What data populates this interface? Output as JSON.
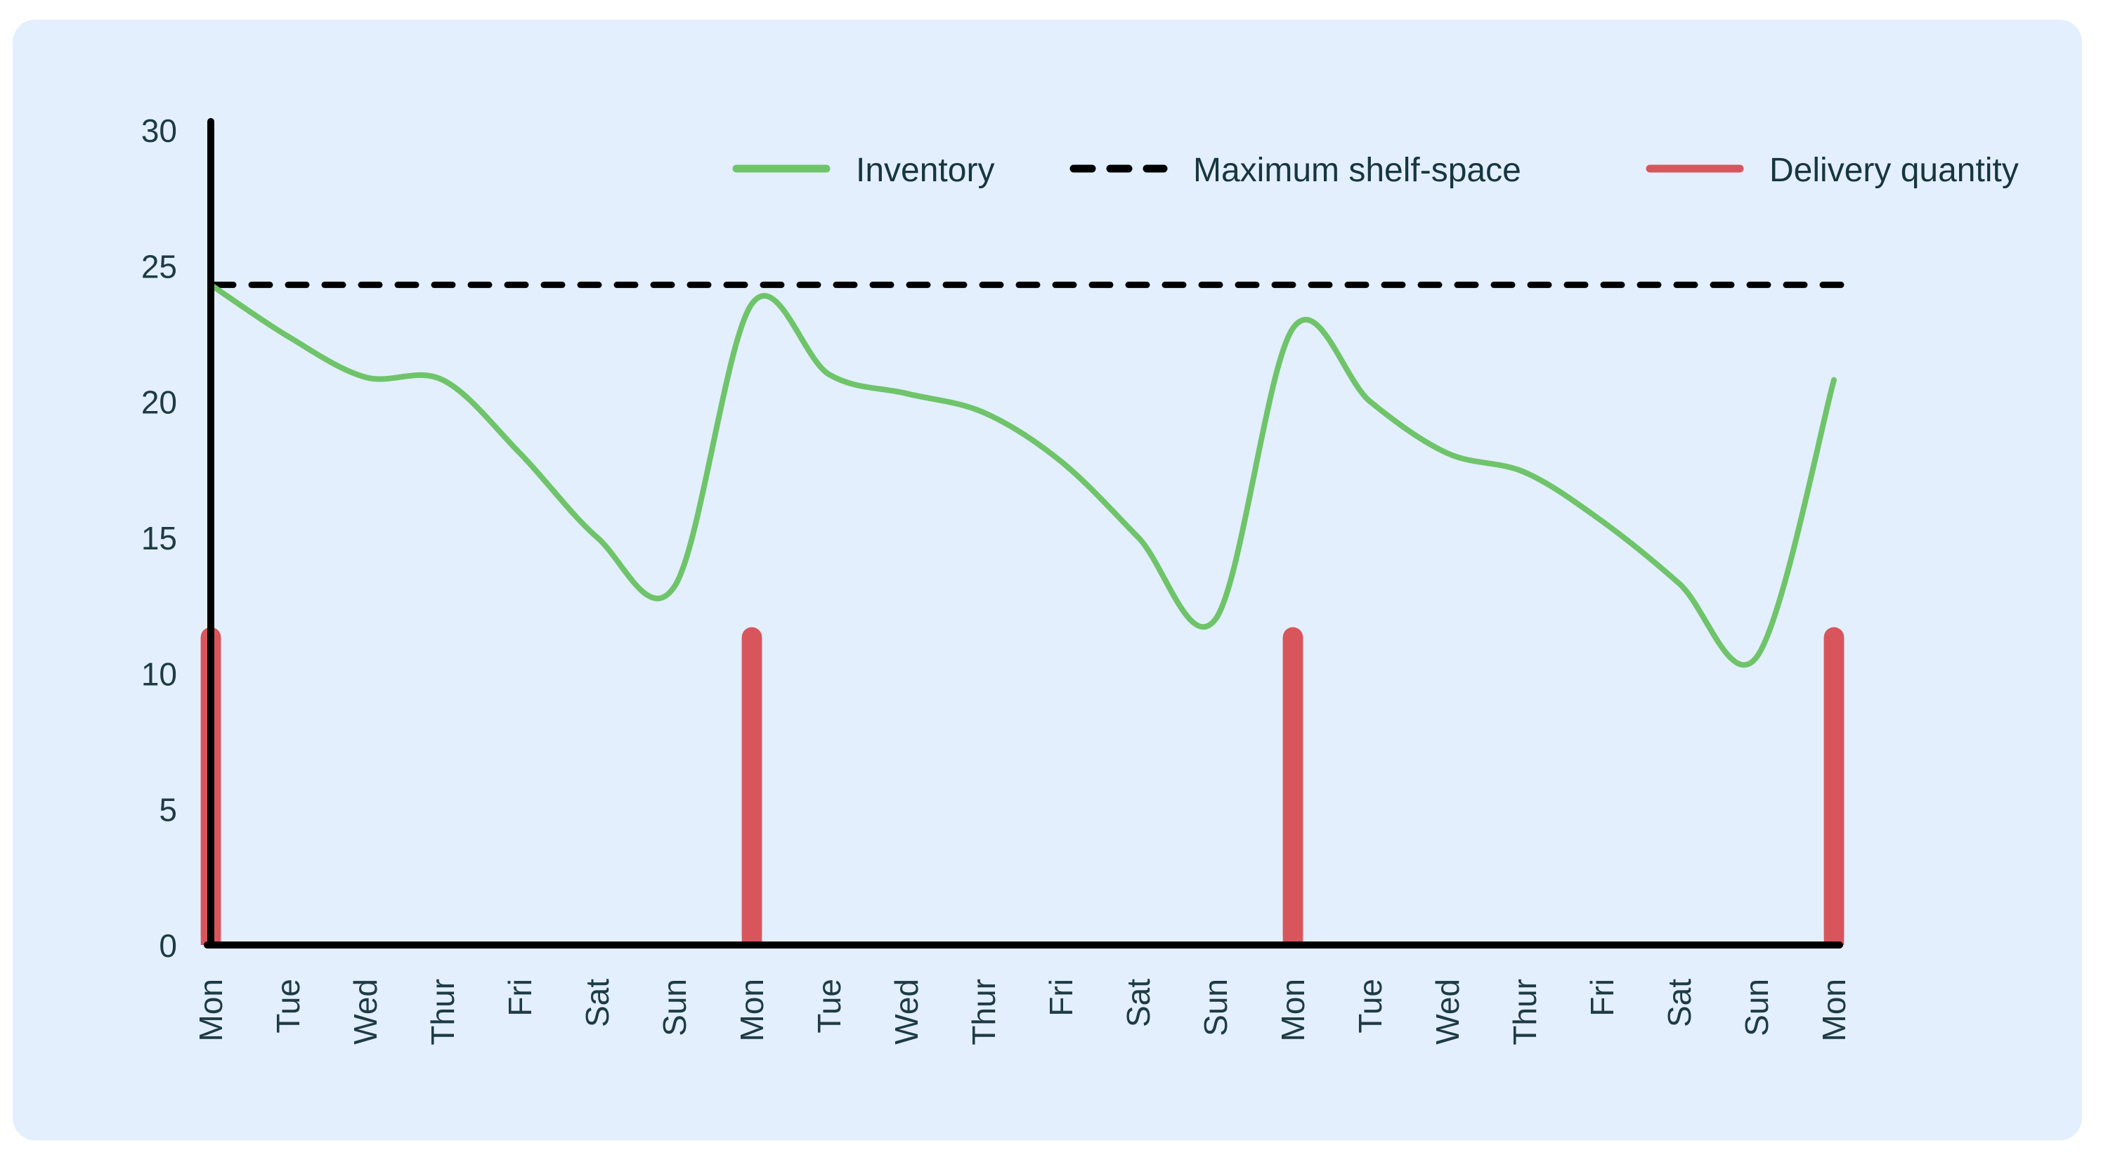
{
  "card": {
    "background_color": "#e3effd",
    "corner_radius": 32
  },
  "chart_data": {
    "type": "line",
    "title": "",
    "subtitle": "",
    "xlabel": "",
    "ylabel": "",
    "xlim": [
      0,
      21
    ],
    "ylim": [
      0,
      30
    ],
    "grid": false,
    "legend_position": "top-center",
    "axis_color": "#000000",
    "tick_label_color": "#1d3b45",
    "x_tick_rotation": -90,
    "categories": [
      "Mon",
      "Tue",
      "Wed",
      "Thur",
      "Fri",
      "Sat",
      "Sun",
      "Mon",
      "Tue",
      "Wed",
      "Thur",
      "Fri",
      "Sat",
      "Sun",
      "Mon",
      "Tue",
      "Wed",
      "Thur",
      "Fri",
      "Sat",
      "Sun",
      "Mon"
    ],
    "y_ticks": [
      0,
      5,
      10,
      15,
      20,
      25,
      30
    ],
    "series": [
      {
        "name": "Inventory",
        "type": "line",
        "color": "#6fc46a",
        "line_width": 8,
        "style": "solid smooth",
        "values": [
          24.3,
          22.4,
          20.9,
          20.8,
          18.1,
          15.0,
          13.2,
          23.6,
          21.0,
          20.3,
          19.6,
          17.8,
          15.0,
          12.0,
          22.7,
          20.0,
          18.1,
          17.4,
          15.6,
          13.3,
          10.6,
          20.8
        ]
      },
      {
        "name": "Maximum shelf-space",
        "type": "hline",
        "color": "#000000",
        "line_width": 9,
        "style": "dashed",
        "value": 24.3
      },
      {
        "name": "Delivery quantity",
        "type": "bar",
        "color": "#d9555c",
        "bar_width": 0.26,
        "rounded_cap": true,
        "categories": [
          "Mon",
          "Mon",
          "Mon",
          "Mon"
        ],
        "indices": [
          0,
          7,
          14,
          21
        ],
        "values": [
          11.7,
          11.7,
          11.7,
          11.7
        ]
      }
    ]
  },
  "legend": {
    "items": [
      {
        "label": "Inventory",
        "marker": "solid-line",
        "color": "#6fc46a"
      },
      {
        "label": "Maximum shelf-space",
        "marker": "dashed-line",
        "color": "#000000"
      },
      {
        "label": "Delivery quantity",
        "marker": "solid-line",
        "color": "#d9555c"
      }
    ]
  }
}
